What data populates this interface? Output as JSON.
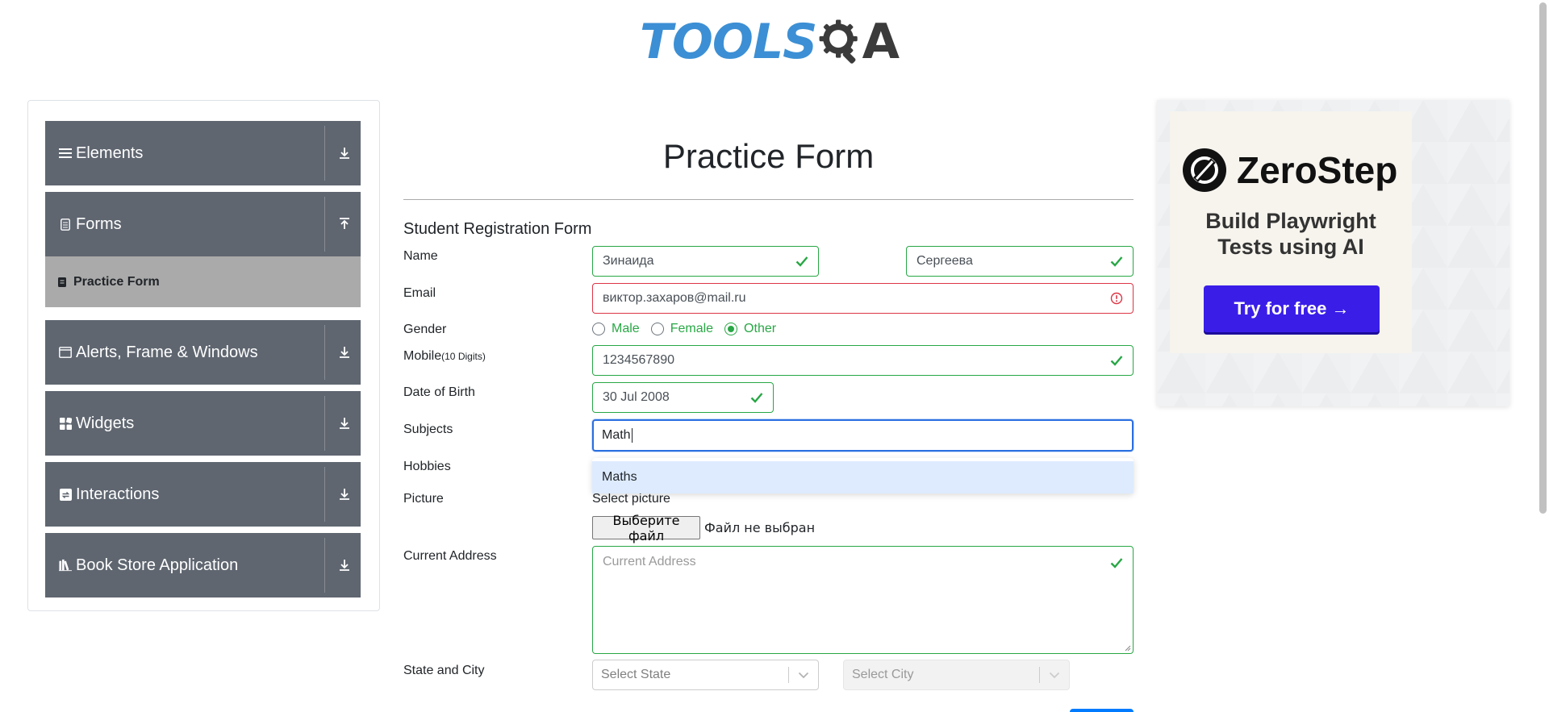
{
  "header": {
    "logo_text_main": "TOOLS",
    "logo_text_tail": "A"
  },
  "sidebar": {
    "groups": [
      {
        "label": "Elements",
        "icon": "hamburger-icon",
        "expanded": false
      },
      {
        "label": "Forms",
        "icon": "document-icon",
        "expanded": true
      },
      {
        "label": "Alerts, Frame & Windows",
        "icon": "window-icon",
        "expanded": false
      },
      {
        "label": "Widgets",
        "icon": "widgets-icon",
        "expanded": false
      },
      {
        "label": "Interactions",
        "icon": "interactions-icon",
        "expanded": false
      },
      {
        "label": "Book Store Application",
        "icon": "books-icon",
        "expanded": false
      }
    ],
    "active_item": {
      "label": "Practice Form",
      "icon": "form-icon"
    }
  },
  "main": {
    "title": "Practice Form",
    "form_heading": "Student Registration Form",
    "labels": {
      "name": "Name",
      "email": "Email",
      "gender": "Gender",
      "mobile": "Mobile",
      "mobile_hint": "(10 Digits)",
      "dob": "Date of Birth",
      "subjects": "Subjects",
      "hobbies": "Hobbies",
      "picture": "Picture",
      "address": "Current Address",
      "state_city": "State and City"
    },
    "first_name": "Зинаида",
    "last_name": "Сергеева",
    "email": "виктор.захаров@mail.ru",
    "gender_options": [
      "Male",
      "Female",
      "Other"
    ],
    "gender_selected": "Other",
    "mobile": "1234567890",
    "dob": "30 Jul 2008",
    "subjects_input": "Math",
    "subject_suggestion": "Maths",
    "select_picture": "Select picture",
    "file_button": "Выберите файл",
    "file_status": "Файл не выбран",
    "address_placeholder": "Current Address",
    "state_placeholder": "Select State",
    "city_placeholder": "Select City"
  },
  "ad": {
    "brand": "ZeroStep",
    "tagline_1": "Build Playwright",
    "tagline_2": "Tests using AI",
    "cta": "Try for free →",
    "cta_color": "#3a1ee8"
  },
  "colors": {
    "valid": "#28a745",
    "invalid": "#dc3545",
    "focus": "#2a6fe0",
    "sidebar_group": "#5f6670",
    "sidebar_active": "#aaaaaa",
    "logo_blue": "#3c8fd4"
  }
}
